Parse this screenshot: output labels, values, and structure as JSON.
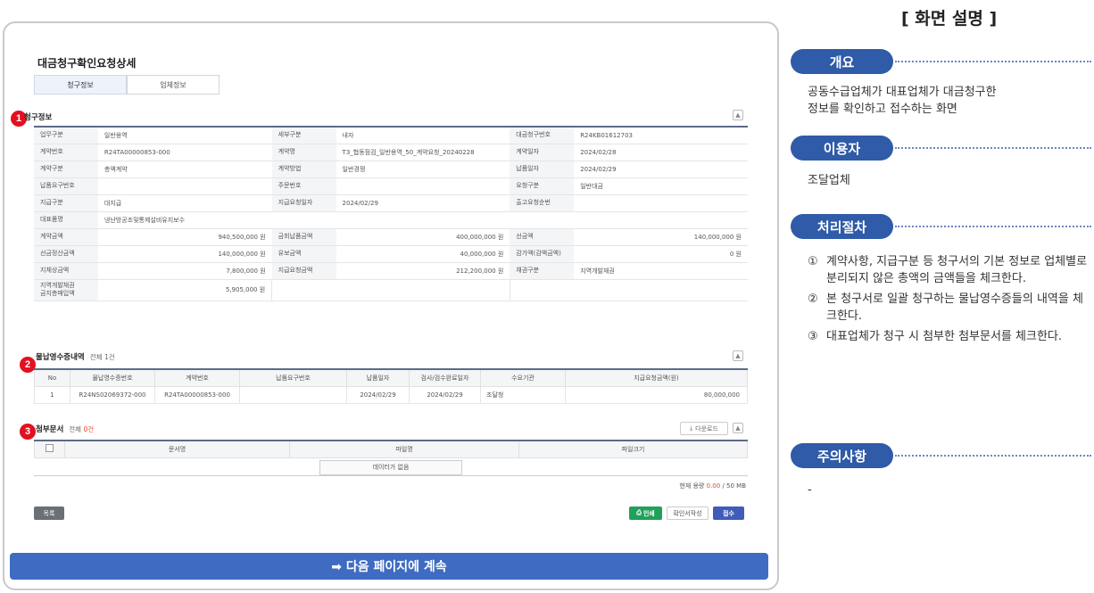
{
  "page_title": "대금청구확인요청상세",
  "tabs": [
    "청구정보",
    "업체정보"
  ],
  "section1": {
    "title": "청구정보",
    "rows": [
      [
        [
          "업무구분",
          "일반용역"
        ],
        [
          "세부구분",
          "내자"
        ],
        [
          "대금청구번호",
          "R24KB01612703"
        ]
      ],
      [
        [
          "계약번호",
          "R24TA00000853-000"
        ],
        [
          "계약명",
          "T3_협동점검_일반용역_50_계약요청_20240228"
        ],
        [
          "계약일자",
          "2024/02/28"
        ]
      ],
      [
        [
          "계약구분",
          "총액계약"
        ],
        [
          "계약방법",
          "일반경쟁"
        ],
        [
          "납품일자",
          "2024/02/29"
        ]
      ],
      [
        [
          "납품요구번호",
          ""
        ],
        [
          "주문번호",
          ""
        ],
        [
          "요청구분",
          "일반대금"
        ]
      ],
      [
        [
          "지급구분",
          "대지급"
        ],
        [
          "지급요청일자",
          "2024/02/29"
        ],
        [
          "출고요청순번",
          ""
        ]
      ],
      [
        [
          "대표품명",
          "냉난방공조및통제설비유지보수"
        ]
      ],
      [
        [
          "계약금액",
          "940,500,000 원"
        ],
        [
          "금회납품금액",
          "400,000,000 원"
        ],
        [
          "선금액",
          "140,000,000 원"
        ]
      ],
      [
        [
          "선금정산금액",
          "140,000,000 원"
        ],
        [
          "유보금액",
          "40,000,000 원"
        ],
        [
          "감가액(감액금액)",
          "0 원"
        ]
      ],
      [
        [
          "지체상금액",
          "7,800,000 원"
        ],
        [
          "지급요청금액",
          "212,200,000 원"
        ],
        [
          "채권구분",
          "지역개발채권"
        ]
      ],
      [
        [
          "지역개발채권\n금지총매입액",
          "5,905,000 원"
        ]
      ]
    ]
  },
  "section2": {
    "title": "물납영수증내역",
    "total_label": "전체",
    "total_count": "1건",
    "headers": [
      "No",
      "물납영수증번호",
      "계약번호",
      "납품요구번호",
      "납품일자",
      "검사/검수완료일자",
      "수요기관",
      "지급요청금액(원)"
    ],
    "rows": [
      [
        "1",
        "R24NS02069372-000",
        "R24TA00000853-000",
        "",
        "2024/02/29",
        "2024/02/29",
        "조달청",
        "80,000,000"
      ]
    ]
  },
  "section3": {
    "title": "첨부문서",
    "total_label": "전체",
    "total_count": "0건",
    "download_label": "다운로드",
    "headers": [
      "문서명",
      "파일명",
      "파일크기"
    ],
    "empty_text": "데이터가 없음",
    "capacity_label": "현재 용량",
    "capacity_used": "0.00",
    "capacity_total": "/ 50 MB"
  },
  "buttons": {
    "list": "목록",
    "print": "인쇄",
    "confirm_write": "확인서작성",
    "receive": "접수"
  },
  "continue_label": "➡ 다음 페이지에 계속",
  "right": {
    "title": "[ 화면 설명 ]",
    "overview_title": "개요",
    "overview_text": "공동수급업체가 대표업체가 대금청구한\n정보를 확인하고 접수하는 화면",
    "user_title": "이용자",
    "user_text": "조달업체",
    "process_title": "처리절차",
    "process_items": [
      [
        "①",
        "계약사항, 지급구분 등 청구서의 기본 정보로 업체별로 분리되지 않은 총액의 금액들을 체크한다."
      ],
      [
        "②",
        "본 청구서로 일괄 청구하는 물납영수증들의 내역을 체크한다."
      ],
      [
        "③",
        "대표업체가 청구 시 첨부한 첨부문서를 체크한다."
      ]
    ],
    "notes_title": "주의사항",
    "notes_text": "-"
  },
  "badges": [
    "1",
    "2",
    "3"
  ]
}
